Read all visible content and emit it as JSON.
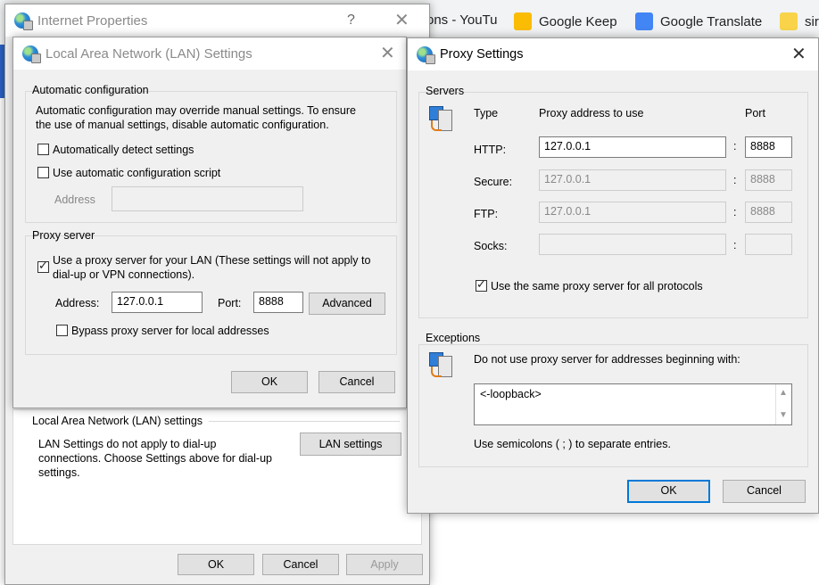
{
  "browser": {
    "bookmarks": [
      {
        "label": "ons - YouTu",
        "icon": "youtube-icon",
        "color": "#ff0000"
      },
      {
        "label": "Google Keep",
        "icon": "keep-icon",
        "color": "#fbbc04"
      },
      {
        "label": "Google Translate",
        "icon": "translate-icon",
        "color": "#4285f4"
      },
      {
        "label": "sir",
        "icon": "folder-icon",
        "color": "#f9d44a"
      }
    ]
  },
  "internet_properties": {
    "title": "Internet Properties",
    "help": "?",
    "lan_group_label": "Local Area Network (LAN) settings",
    "lan_description": [
      "LAN Settings do not apply to dial-up",
      "connections. Choose Settings above for dial-up",
      "settings."
    ],
    "lan_settings_button": "LAN settings",
    "ok": "OK",
    "cancel": "Cancel",
    "apply": "Apply"
  },
  "lan_dialog": {
    "title": "Local Area Network (LAN) Settings",
    "auto_group_label": "Automatic configuration",
    "auto_description": [
      "Automatic configuration may override manual settings.  To ensure",
      "the use of manual settings, disable automatic configuration."
    ],
    "auto_detect_label": "Automatically detect settings",
    "auto_detect_checked": false,
    "auto_script_label": "Use automatic configuration script",
    "auto_script_checked": false,
    "script_address_label": "Address",
    "script_address_value": "",
    "proxy_group_label": "Proxy server",
    "use_proxy_label": [
      "Use a proxy server for your LAN (These settings will not apply to",
      "dial-up or VPN connections)."
    ],
    "use_proxy_checked": true,
    "address_label": "Address:",
    "address_value": "127.0.0.1",
    "port_label": "Port:",
    "port_value": "8888",
    "advanced_button": "Advanced",
    "bypass_label": "Bypass proxy server for local addresses",
    "bypass_checked": false,
    "ok": "OK",
    "cancel": "Cancel"
  },
  "proxy_dialog": {
    "title": "Proxy Settings",
    "servers_group_label": "Servers",
    "col_type": "Type",
    "col_address": "Proxy address to use",
    "col_port": "Port",
    "rows": [
      {
        "type": "HTTP:",
        "address": "127.0.0.1",
        "port": "8888",
        "enabled": true
      },
      {
        "type": "Secure:",
        "address": "127.0.0.1",
        "port": "8888",
        "enabled": false
      },
      {
        "type": "FTP:",
        "address": "127.0.0.1",
        "port": "8888",
        "enabled": false
      },
      {
        "type": "Socks:",
        "address": "",
        "port": "",
        "enabled": false
      }
    ],
    "colon": ":",
    "same_proxy_label": "Use the same proxy server for all protocols",
    "same_proxy_checked": true,
    "exceptions_group_label": "Exceptions",
    "exceptions_description": "Do not use proxy server for addresses beginning with:",
    "exceptions_value": "<-loopback>",
    "exceptions_hint": "Use semicolons ( ; ) to separate entries.",
    "ok": "OK",
    "cancel": "Cancel"
  }
}
